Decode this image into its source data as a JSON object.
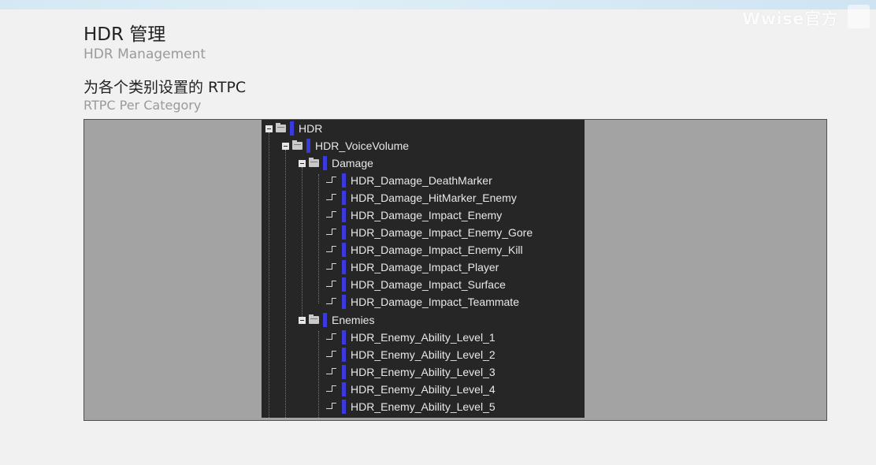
{
  "header": {
    "title_cn": "HDR 管理",
    "title_en": "HDR Management",
    "subtitle_cn": "为各个类别设置的 RTPC",
    "subtitle_en": "RTPC Per Category"
  },
  "watermark": {
    "text": "Wwise官方"
  },
  "colors": {
    "rtpc_bar": "#3a3adf",
    "panel_bg": "#262626",
    "frame_bg": "#a3a3a3",
    "page_bg": "#f1f1f1"
  },
  "tree": {
    "root": {
      "label": "HDR",
      "icon": "folder-icon"
    },
    "voice_volume": {
      "label": "HDR_VoiceVolume",
      "icon": "folder-icon"
    },
    "damage": {
      "label": "Damage",
      "icon": "folder-icon",
      "items": [
        "HDR_Damage_DeathMarker",
        "HDR_Damage_HitMarker_Enemy",
        "HDR_Damage_Impact_Enemy",
        "HDR_Damage_Impact_Enemy_Gore",
        "HDR_Damage_Impact_Enemy_Kill",
        "HDR_Damage_Impact_Player",
        "HDR_Damage_Impact_Surface",
        "HDR_Damage_Impact_Teammate"
      ]
    },
    "enemies": {
      "label": "Enemies",
      "icon": "folder-icon",
      "items": [
        "HDR_Enemy_Ability_Level_1",
        "HDR_Enemy_Ability_Level_2",
        "HDR_Enemy_Ability_Level_3",
        "HDR_Enemy_Ability_Level_4",
        "HDR_Enemy_Ability_Level_5"
      ]
    }
  }
}
